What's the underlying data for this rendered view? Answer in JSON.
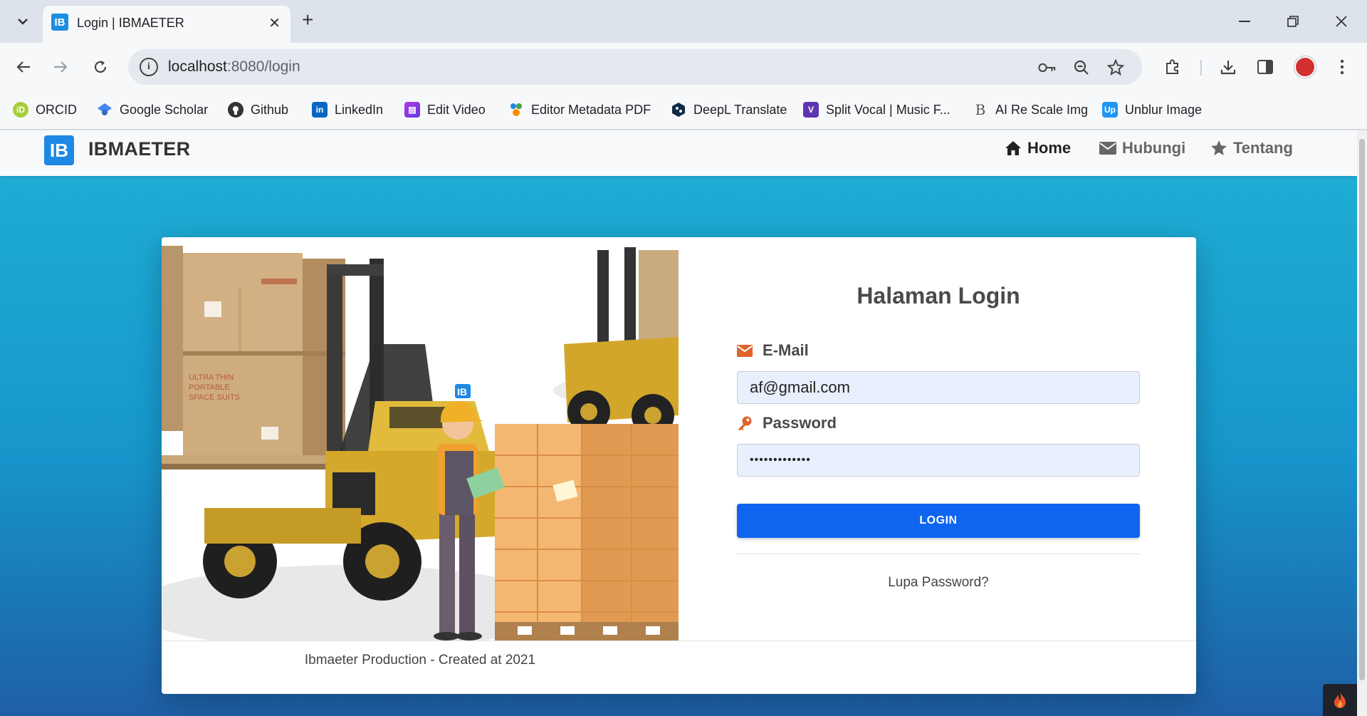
{
  "browser": {
    "tab_title": "Login | IBMAETER",
    "tab_favicon_text": "IB",
    "url_host": "localhost",
    "url_path": ":8080/login",
    "bookmarks": [
      {
        "label": "ORCID",
        "icon": "orcid-icon",
        "color": "#a6ce39"
      },
      {
        "label": "Google Scholar",
        "icon": "google-scholar-icon",
        "color": "#4285f4"
      },
      {
        "label": "Github",
        "icon": "github-icon",
        "color": "#333333"
      },
      {
        "label": "LinkedIn",
        "icon": "linkedin-icon",
        "color": "#0a66c2"
      },
      {
        "label": "Edit Video",
        "icon": "edit-video-icon",
        "color": "#7c4dff"
      },
      {
        "label": "Editor Metadata PDF",
        "icon": "pdf-metadata-icon",
        "color": "#1e88e5"
      },
      {
        "label": "DeepL Translate",
        "icon": "deepl-icon",
        "color": "#0f2b46"
      },
      {
        "label": "Split Vocal | Music F...",
        "icon": "split-vocal-icon",
        "color": "#5e35b1"
      },
      {
        "label": "AI Re Scale Img",
        "icon": "ai-rescale-icon",
        "color": "#555555"
      },
      {
        "label": "Unblur Image",
        "icon": "unblur-icon",
        "color": "#2196f3"
      }
    ]
  },
  "site": {
    "brand_logo_text": "IB",
    "brand_name": "IBMAETER",
    "nav": {
      "home": "Home",
      "contact": "Hubungi",
      "about": "Tentang"
    }
  },
  "login": {
    "title": "Halaman Login",
    "email_label": "E-Mail",
    "email_value": "af@gmail.com",
    "password_label": "Password",
    "password_value": "•••••••••••••",
    "button_label": "LOGIN",
    "forgot_label": "Lupa Password?",
    "footer": "Ibmaeter Production - Created at 2021",
    "helmet_badge": "IB"
  },
  "colors": {
    "primary_button": "#0f65ef",
    "accent_icon": "#e0632a",
    "background_top": "#1fb0d6",
    "background_bottom": "#1e5fa6",
    "brand_logo": "#1e88e5"
  }
}
